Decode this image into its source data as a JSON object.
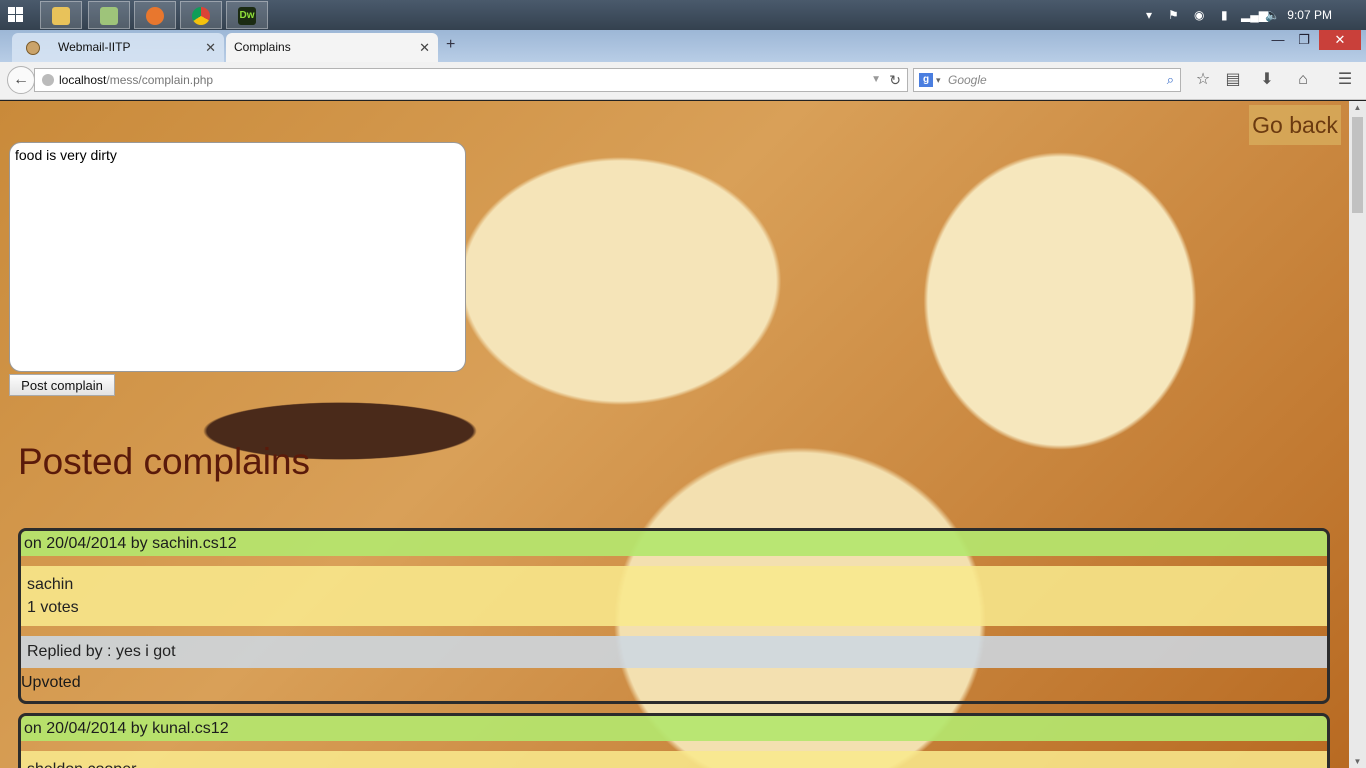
{
  "taskbar": {
    "apps": [
      "file-explorer-icon",
      "files-icon",
      "firefox-icon",
      "chrome-icon",
      "dreamweaver-icon"
    ],
    "dw_label": "Dw",
    "clock": "9:07 PM"
  },
  "browser": {
    "tabs": [
      {
        "label": "Webmail-IITP",
        "active": false
      },
      {
        "label": "Complains",
        "active": true
      }
    ],
    "url": {
      "host": "localhost",
      "path": "/mess/complain.php"
    },
    "search_placeholder": "Google",
    "search_engine_badge": "g"
  },
  "page": {
    "go_back": "Go back",
    "complain_text": "food is very dirty",
    "post_button": "Post complain",
    "posted_title": "Posted complains",
    "complains": [
      {
        "header": "on 20/04/2014 by sachin.cs12",
        "text": "sachin",
        "votes": "1 votes",
        "reply": "Replied by : yes i got",
        "status": "Upvoted"
      },
      {
        "header": "on 20/04/2014 by kunal.cs12",
        "text": "sheldon cooper"
      }
    ]
  }
}
